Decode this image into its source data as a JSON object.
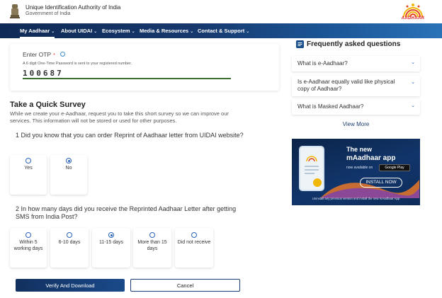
{
  "header": {
    "org_name": "Unique Identification Authority of India",
    "org_sub": "Government of India",
    "logo_text": "AADHAAR"
  },
  "nav": {
    "items": [
      {
        "label": "My Aadhaar"
      },
      {
        "label": "About UIDAI"
      },
      {
        "label": "Ecosystem"
      },
      {
        "label": "Media & Resources"
      },
      {
        "label": "Contact & Support"
      }
    ],
    "caret": "⌄"
  },
  "otp": {
    "label": "Enter OTP",
    "required_mark": "*",
    "hint": "A 6 digit One-Time Password is sent to your registered number.",
    "value": "100687"
  },
  "survey": {
    "title": "Take a Quick Survey",
    "description": "While we create your e-Aadhaar, request you to take this short survey so we can improve our services. This information will not be stored or used for other purposes.",
    "q1": {
      "text": "1 Did you know that you can order Reprint of Aadhaar letter from UIDAI website?",
      "options": [
        {
          "label": "Yes",
          "selected": false
        },
        {
          "label": "No",
          "selected": true
        }
      ]
    },
    "q2": {
      "text": "2 In how many days did you receive the Reprinted Aadhaar Letter after getting SMS from India Post?",
      "options": [
        {
          "label": "Within 5 working days",
          "selected": false
        },
        {
          "label": "6-10 days",
          "selected": false
        },
        {
          "label": "11-15 days",
          "selected": true
        },
        {
          "label": "More than 15 days",
          "selected": false
        },
        {
          "label": "Did not receive",
          "selected": false
        }
      ]
    }
  },
  "actions": {
    "verify_label": "Verify And Download",
    "cancel_label": "Cancel"
  },
  "faq": {
    "title": "Frequently asked questions",
    "items": [
      {
        "text": "What is e-Aadhaar?"
      },
      {
        "text": "Is e-Aadhaar equally valid like physical copy of Aadhaar?"
      },
      {
        "text": "What is Masked Aadhaar?"
      }
    ],
    "chevron": "⌄",
    "view_more": "View More"
  },
  "banner": {
    "line1": "The new",
    "line2": "mAadhaar app",
    "avail": "now available on",
    "store": "Google Play",
    "install": "INSTALL NOW",
    "footer": "Uninstall any previous version and install the new mAadhaar App"
  }
}
